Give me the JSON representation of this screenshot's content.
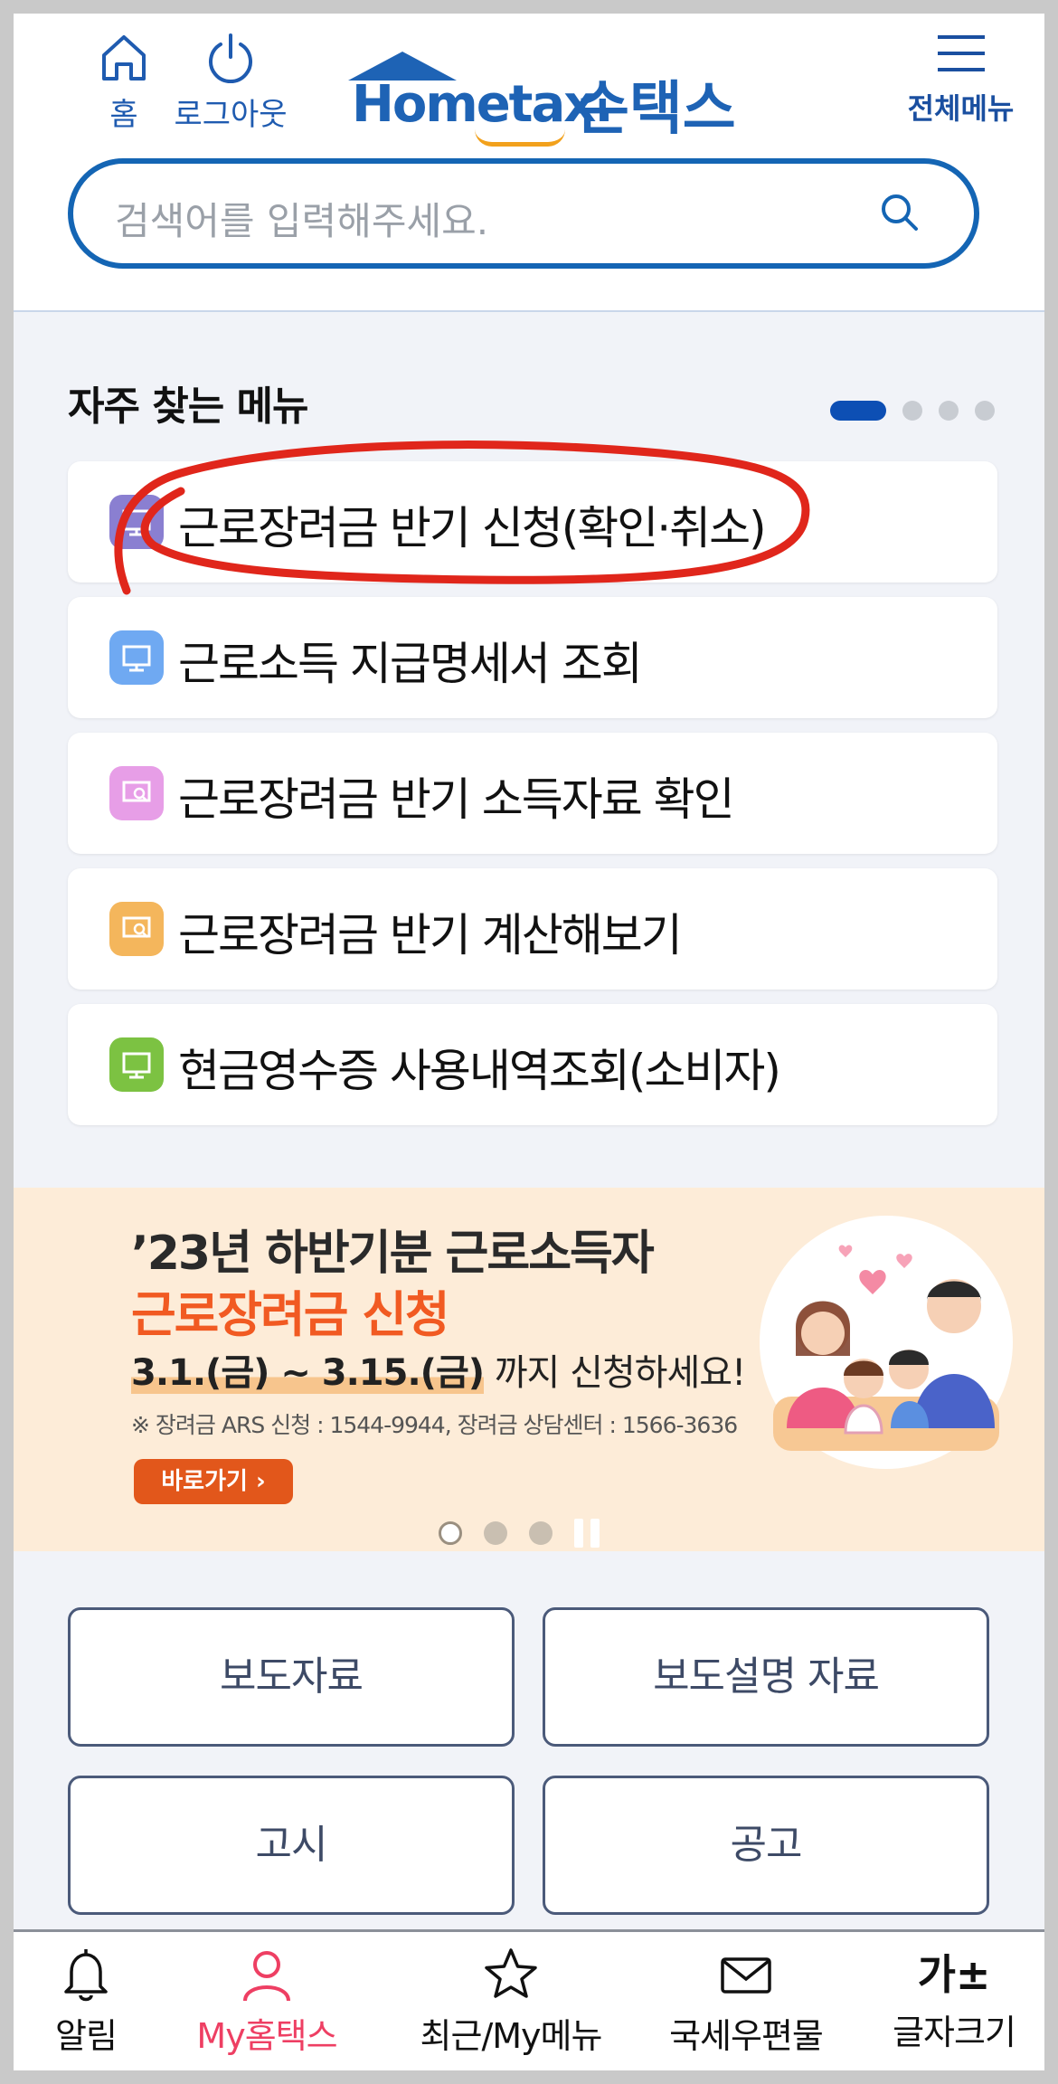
{
  "header": {
    "home_label": "홈",
    "logout_label": "로그아웃",
    "logo_home": "Hometax.",
    "logo_son": "손택스",
    "all_menu_label": "전체메뉴"
  },
  "search": {
    "placeholder": "검색어를 입력해주세요."
  },
  "frequent": {
    "title": "자주 찾는 메뉴",
    "items": [
      {
        "label": "근로장려금 반기 신청(확인·취소)",
        "icon": "monitor-icon",
        "color": "#8a7fd1"
      },
      {
        "label": "근로소득 지급명세서 조회",
        "icon": "monitor-icon",
        "color": "#6fa9f2"
      },
      {
        "label": "근로장려금 반기 소득자료 확인",
        "icon": "monitor-search-icon",
        "color": "#e79ee7"
      },
      {
        "label": "근로장려금 반기 계산해보기",
        "icon": "monitor-search-icon",
        "color": "#f4b65c"
      },
      {
        "label": "현금영수증 사용내역조회(소비자)",
        "icon": "monitor-icon",
        "color": "#7cc242"
      }
    ]
  },
  "banner": {
    "line1": "’23년 하반기분 근로소득자",
    "line2": "근로장려금 신청",
    "period": "3.1.(금) ~ 3.15.(금)",
    "period_suffix": " 까지 신청하세요!",
    "note": "※ 장려금 ARS 신청 : 1544-9944, 장려금 상담센터 : 1566-3636",
    "go_label": "바로가기 ›"
  },
  "buttons": {
    "press": "보도자료",
    "press_explain": "보도설명 자료",
    "notice": "고시",
    "announce": "공고"
  },
  "bottom_nav": {
    "alert": "알림",
    "my_hometax": "My홈택스",
    "recent": "최근/My메뉴",
    "mail": "국세우편물",
    "font_size": "글자크기",
    "font_size_glyph": "가±"
  },
  "colors": {
    "brand": "#1e63b5",
    "accent_orange": "#f15a22",
    "active_nav": "#ee3f63",
    "annotation_red": "#e0261b"
  }
}
